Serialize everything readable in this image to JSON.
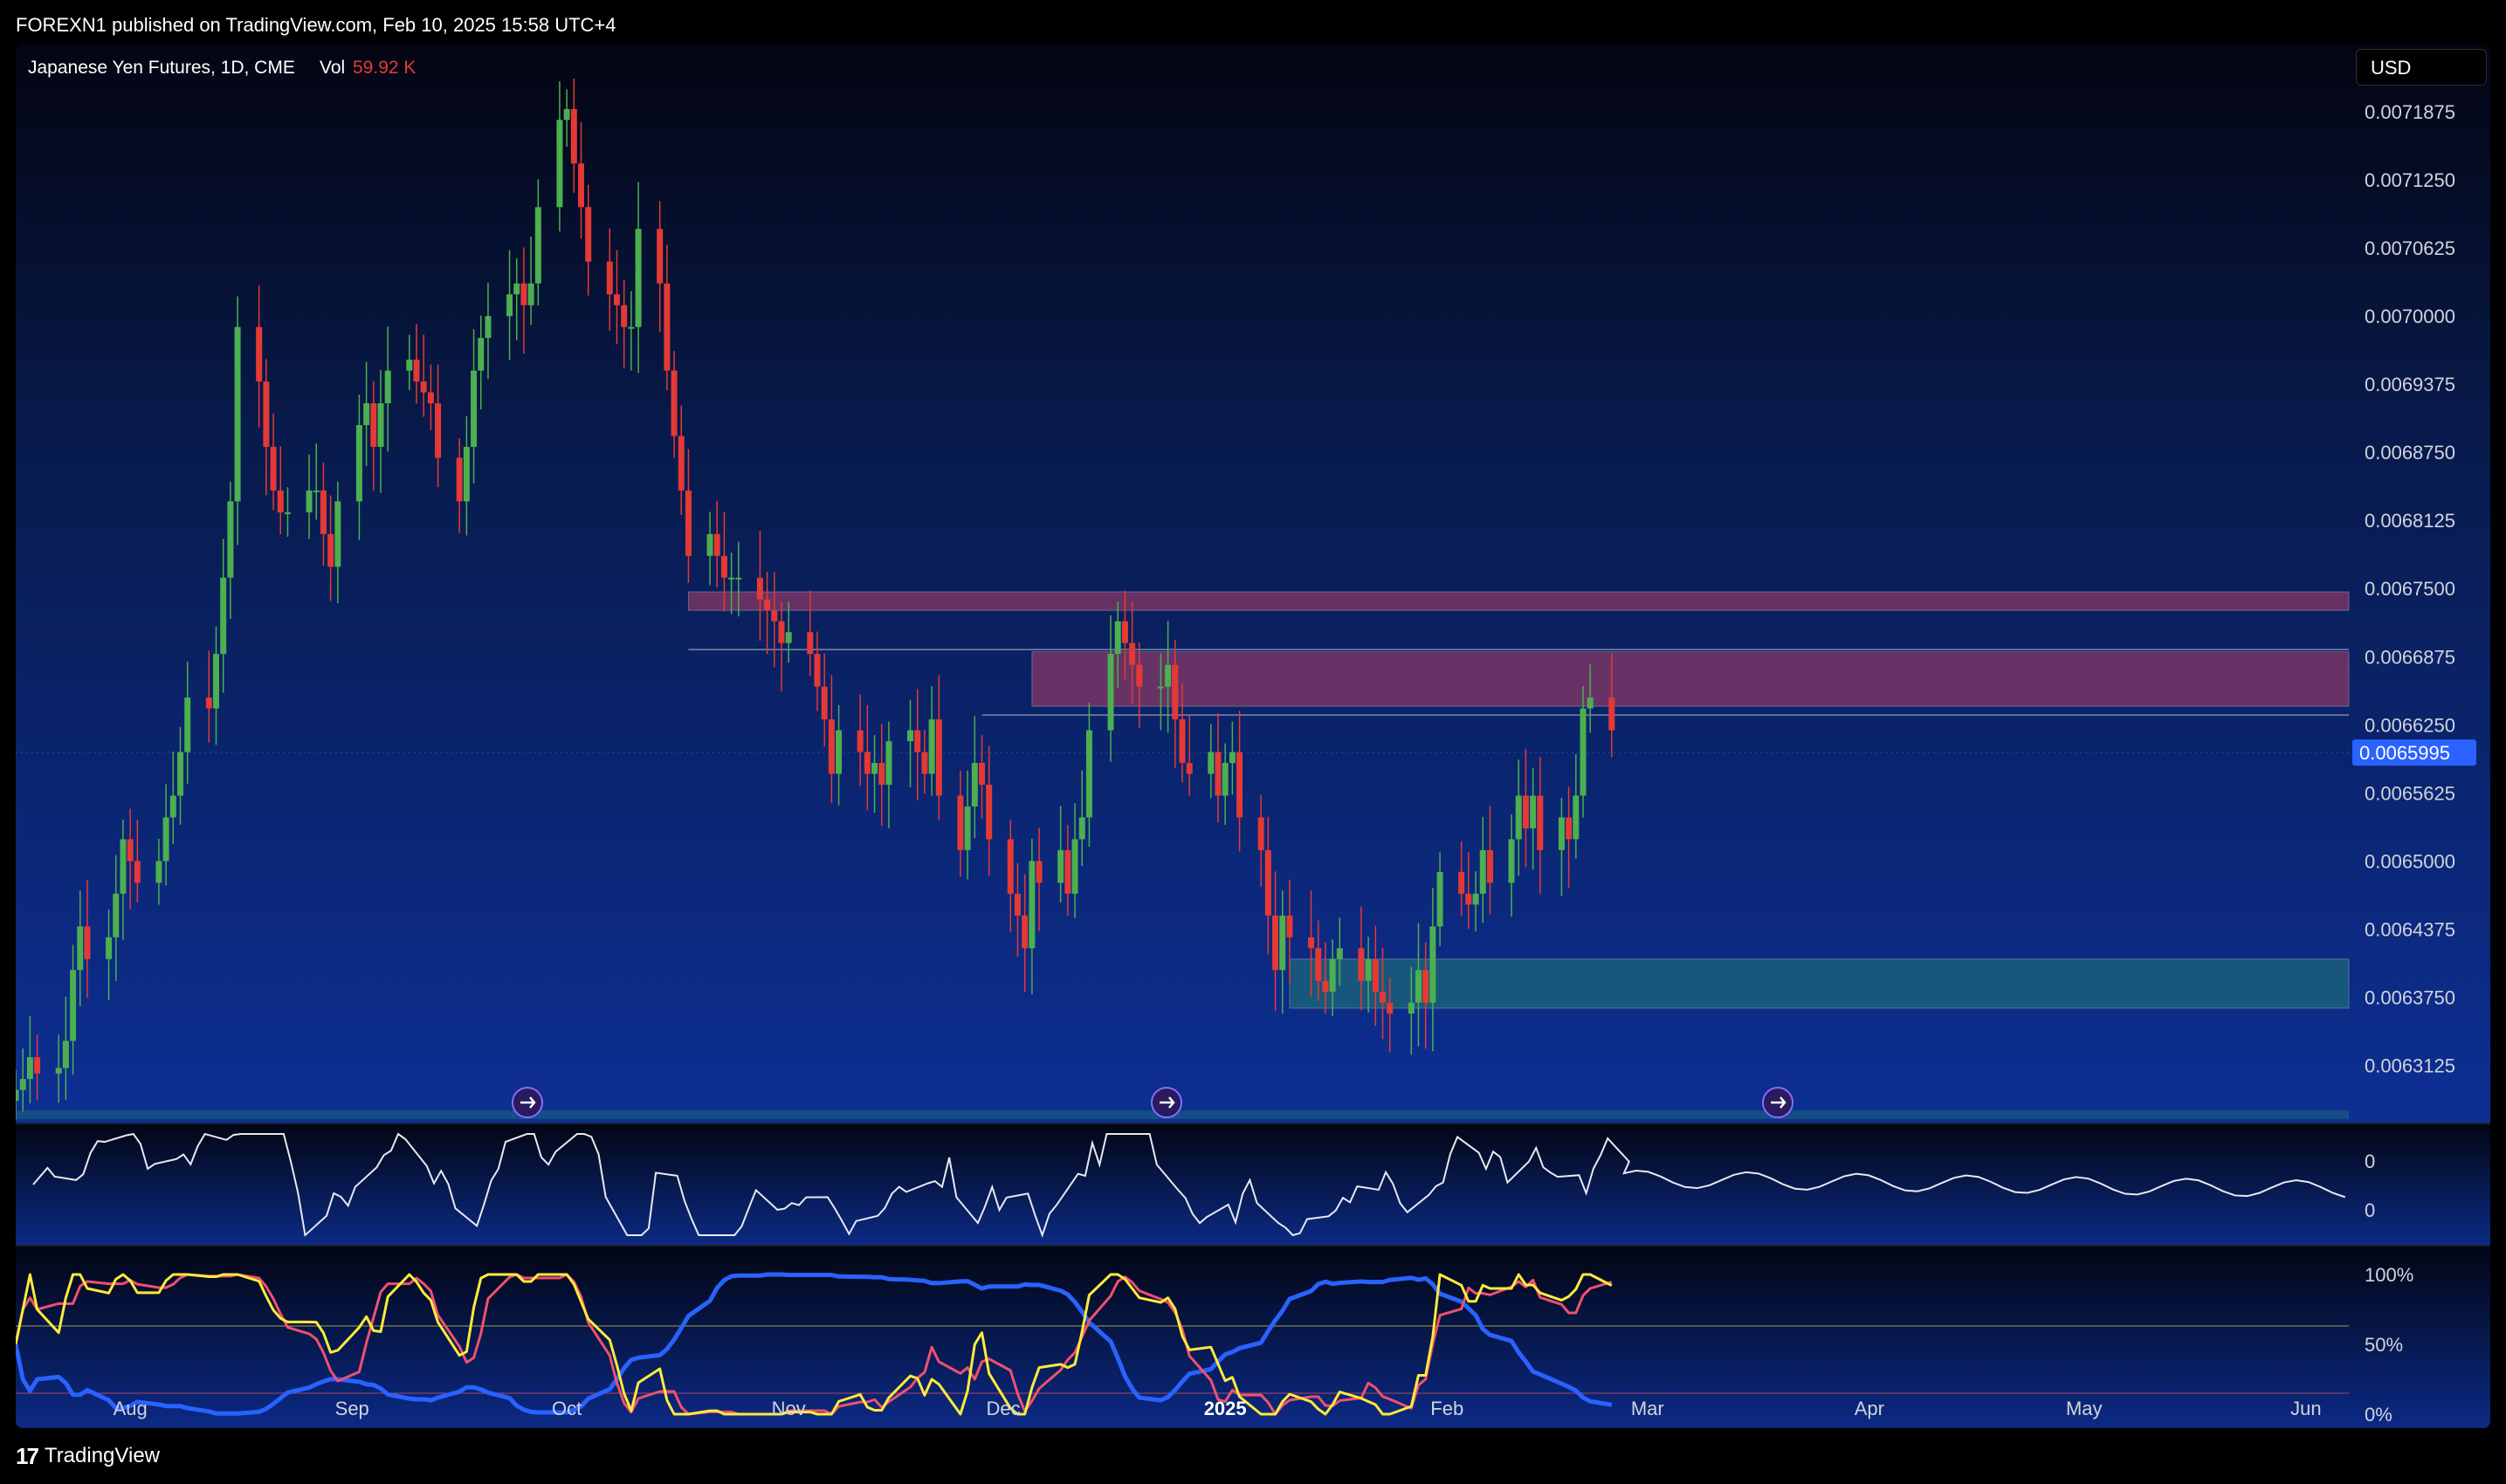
{
  "header": {
    "publish_text": "FOREXN1 published on TradingView.com, Feb 10, 2025 15:58 UTC+4"
  },
  "legend": {
    "symbol": "Japanese Yen Futures, 1D, CME",
    "vol_label": "Vol",
    "vol_value": "59.92 K"
  },
  "currency_button": {
    "label": "USD"
  },
  "footer": {
    "brand": "TradingView"
  },
  "colors": {
    "up": "#4caf50",
    "down": "#e53935",
    "supply_zone": "#8e3a67",
    "demand_zone": "#1e6b78",
    "price_tag": "#2962ff",
    "stoch_blue": "#2962ff",
    "stoch_red": "#f0506e",
    "stoch_yellow": "#ffeb3b"
  },
  "chart_data": {
    "type": "candlestick",
    "price_axis": {
      "ticks": [
        "0.0071875",
        "0.0071250",
        "0.0070625",
        "0.0070000",
        "0.0069375",
        "0.0068750",
        "0.0068125",
        "0.0067500",
        "0.0066875",
        "0.0066250",
        "0.0065625",
        "0.0065000",
        "0.0064375",
        "0.0063750",
        "0.0063125"
      ],
      "ylim": [
        0.00626,
        0.00725
      ],
      "last_price": "0.0065995"
    },
    "time_axis": {
      "labels": [
        "Aug",
        "Sep",
        "Oct",
        "Nov",
        "Dec",
        "2025",
        "Feb",
        "Mar",
        "Apr",
        "May",
        "Jun"
      ],
      "label_dates": [
        "2024-08-01",
        "2024-09-01",
        "2024-10-01",
        "2024-11-01",
        "2024-12-01",
        "2025-01-01",
        "2025-02-01",
        "2025-03-01",
        "2025-04-01",
        "2025-05-01",
        "2025-06-01"
      ]
    },
    "zones": [
      {
        "type": "supply",
        "top": 0.006747,
        "bottom": 0.00673,
        "from": "2024-10-18"
      },
      {
        "type": "supply",
        "top": 0.006692,
        "bottom": 0.006642,
        "from": "2024-12-05"
      },
      {
        "type": "demand",
        "top": 0.00641,
        "bottom": 0.006365,
        "from": "2025-01-10"
      }
    ],
    "levels": [
      {
        "price": 0.006694,
        "from": "2024-10-18"
      },
      {
        "price": 0.006634,
        "from": "2024-11-28"
      }
    ],
    "closes_dates": [
      "2024-07-16",
      "2025-02-07"
    ],
    "closes": [
      0.00629,
      0.0063,
      0.00632,
      0.006305,
      0.00631,
      0.006335,
      0.0064,
      0.00644,
      0.00641,
      0.00643,
      0.00647,
      0.00652,
      0.0065,
      0.00648,
      0.0065,
      0.00654,
      0.00656,
      0.0066,
      0.00665,
      0.00664,
      0.00669,
      0.00676,
      0.00683,
      0.00699,
      0.00694,
      0.00688,
      0.00684,
      0.00682,
      0.00682,
      0.00684,
      0.00684,
      0.0068,
      0.00677,
      0.00683,
      0.0069,
      0.00692,
      0.00688,
      0.00692,
      0.00695,
      0.00696,
      0.00694,
      0.00693,
      0.00692,
      0.00687,
      0.00683,
      0.00688,
      0.00695,
      0.00698,
      0.007,
      0.00702,
      0.00703,
      0.00701,
      0.00703,
      0.0071,
      0.00718,
      0.00719,
      0.00714,
      0.0071,
      0.00705,
      0.00702,
      0.00701,
      0.00699,
      0.00699,
      0.00708,
      0.00703,
      0.00695,
      0.00689,
      0.00684,
      0.00678,
      0.0068,
      0.00678,
      0.00676,
      0.00676,
      0.00676,
      0.00674,
      0.00673,
      0.00672,
      0.0067,
      0.00671,
      0.00669,
      0.00666,
      0.00663,
      0.00658,
      0.00662,
      0.0066,
      0.00658,
      0.00659,
      0.00657,
      0.00661,
      0.00662,
      0.0066,
      0.00658,
      0.00663,
      0.00656,
      0.00651,
      0.00655,
      0.00659,
      0.00657,
      0.00652,
      0.00647,
      0.00645,
      0.00642,
      0.0065,
      0.00648,
      0.00651,
      0.00647,
      0.00652,
      0.00654,
      0.00662,
      0.00669,
      0.00672,
      0.0067,
      0.00668,
      0.00666,
      0.00666,
      0.00668,
      0.00663,
      0.00659,
      0.00658,
      0.0066,
      0.00656,
      0.00659,
      0.0066,
      0.00654,
      0.00651,
      0.00645,
      0.0064,
      0.00645,
      0.00643,
      0.00642,
      0.00639,
      0.00638,
      0.00641,
      0.00642,
      0.00639,
      0.00641,
      0.00638,
      0.00637,
      0.00636,
      0.00637,
      0.0064,
      0.00637,
      0.00644,
      0.00649,
      0.00647,
      0.00646,
      0.00647,
      0.00651,
      0.00648,
      0.00652,
      0.00656,
      0.00653,
      0.00656,
      0.00651,
      0.00654,
      0.00652,
      0.00656,
      0.00664,
      0.00665,
      0.00662
    ],
    "rsi_axis": {
      "ticks": [
        "0",
        "0"
      ]
    },
    "stoch_axis": {
      "ticks": [
        "100%",
        "50%",
        "0%"
      ]
    }
  }
}
